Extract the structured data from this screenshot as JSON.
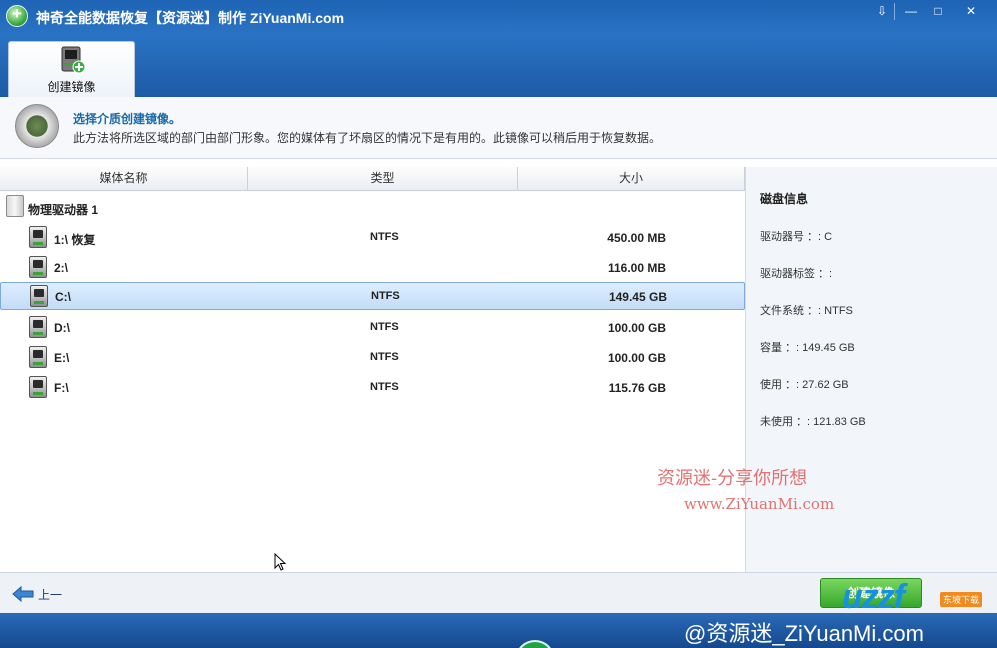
{
  "window": {
    "title": "神奇全能数据恢复【资源迷】制作 ZiYuanMi.com",
    "buttons": {
      "download": "⇩",
      "minimize": "—",
      "maximize": "□",
      "close": "✕"
    }
  },
  "tabs": [
    {
      "label": "创建镜像",
      "active": true
    }
  ],
  "info": {
    "title": "选择介质创建镜像。",
    "description": "此方法将所选区域的部门由部门形象。您的媒体有了坏扇区的情况下是有用的。此镜像可以稍后用于恢复数据。"
  },
  "table": {
    "columns": [
      "媒体名称",
      "类型",
      "大小"
    ],
    "group": {
      "label": "物理驱动器 1"
    },
    "rows": [
      {
        "name": "1:\\ 恢复",
        "type": "NTFS",
        "size": "450.00 MB",
        "selected": false
      },
      {
        "name": "2:\\",
        "type": "",
        "size": "116.00 MB",
        "selected": false
      },
      {
        "name": "C:\\",
        "type": "NTFS",
        "size": "149.45 GB",
        "selected": true
      },
      {
        "name": "D:\\",
        "type": "NTFS",
        "size": "100.00 GB",
        "selected": false
      },
      {
        "name": "E:\\",
        "type": "NTFS",
        "size": "100.00 GB",
        "selected": false
      },
      {
        "name": "F:\\",
        "type": "NTFS",
        "size": "115.76 GB",
        "selected": false
      }
    ]
  },
  "disk_info": {
    "title": "磁盘信息",
    "items": [
      "驱动器号 ：: C",
      "驱动器标签 ：:",
      "文件系统 ：: NTFS",
      "容量 ：: 149.45 GB",
      "使用 ：: 27.62 GB",
      "未使用 ：: 121.83 GB"
    ]
  },
  "watermark": {
    "line1": "资源迷-分享你所想",
    "line2": "www.ZiYuanMi.com",
    "bottom": "@资源迷_ZiYuanMi.com",
    "uzzf": "uzzf",
    "uzzf_badge": "东坡下载"
  },
  "footer": {
    "back_label": "上一",
    "next_label": "创建镜像"
  },
  "colors": {
    "titlebar": "#1e63b4",
    "accent": "#1a6aa8",
    "selected_row": "#c4dcf7",
    "next_button": "#35a82c"
  }
}
